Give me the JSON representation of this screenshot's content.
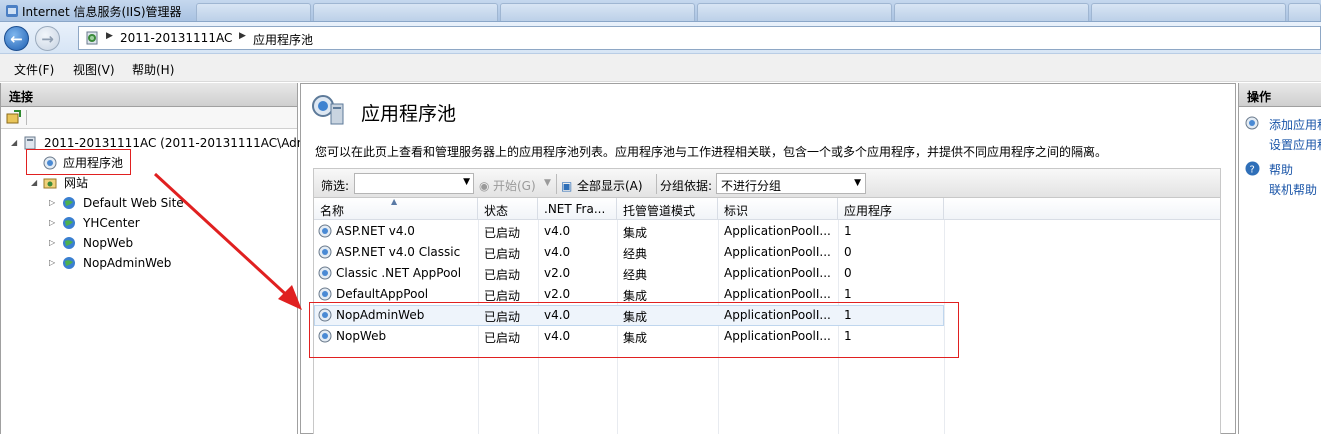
{
  "window": {
    "title": "Internet 信息服务(IIS)管理器"
  },
  "address": {
    "crumbs": [
      "2011-20131111AC",
      "应用程序池"
    ]
  },
  "menu": {
    "items": [
      "文件(F)",
      "视图(V)",
      "帮助(H)"
    ]
  },
  "connections": {
    "header": "连接",
    "server_node": "2011-20131111AC (2011-20131111AC\\Adm",
    "app_pools_node": "应用程序池",
    "sites_node": "网站",
    "sites": [
      "Default Web Site",
      "YHCenter",
      "NopWeb",
      "NopAdminWeb"
    ]
  },
  "main": {
    "title": "应用程序池",
    "description": "您可以在此页上查看和管理服务器上的应用程序池列表。应用程序池与工作进程相关联，包含一个或多个应用程序，并提供不同应用程序之间的隔离。",
    "filter_label": "筛选:",
    "start_label": "开始(G)",
    "show_all_label": "全部显示(A)",
    "group_by_label": "分组依据:",
    "group_by_value": "不进行分组",
    "columns": [
      "名称",
      "状态",
      ".NET Fra...",
      "托管管道模式",
      "标识",
      "应用程序"
    ],
    "rows": [
      {
        "name": "ASP.NET v4.0",
        "status": "已启动",
        "net": "v4.0",
        "pipeline": "集成",
        "identity": "ApplicationPoolI...",
        "apps": "1"
      },
      {
        "name": "ASP.NET v4.0 Classic",
        "status": "已启动",
        "net": "v4.0",
        "pipeline": "经典",
        "identity": "ApplicationPoolI...",
        "apps": "0"
      },
      {
        "name": "Classic .NET AppPool",
        "status": "已启动",
        "net": "v2.0",
        "pipeline": "经典",
        "identity": "ApplicationPoolI...",
        "apps": "0"
      },
      {
        "name": "DefaultAppPool",
        "status": "已启动",
        "net": "v2.0",
        "pipeline": "集成",
        "identity": "ApplicationPoolI...",
        "apps": "1"
      },
      {
        "name": "NopAdminWeb",
        "status": "已启动",
        "net": "v4.0",
        "pipeline": "集成",
        "identity": "ApplicationPoolI...",
        "apps": "1"
      },
      {
        "name": "NopWeb",
        "status": "已启动",
        "net": "v4.0",
        "pipeline": "集成",
        "identity": "ApplicationPoolI...",
        "apps": "1"
      }
    ]
  },
  "actions": {
    "header": "操作",
    "add_pool": "添加应用程",
    "set_defaults": "设置应用程",
    "help": "帮助",
    "online_help": "联机帮助"
  },
  "colors": {
    "annotation": "#e02020",
    "link": "#1a55a8"
  }
}
